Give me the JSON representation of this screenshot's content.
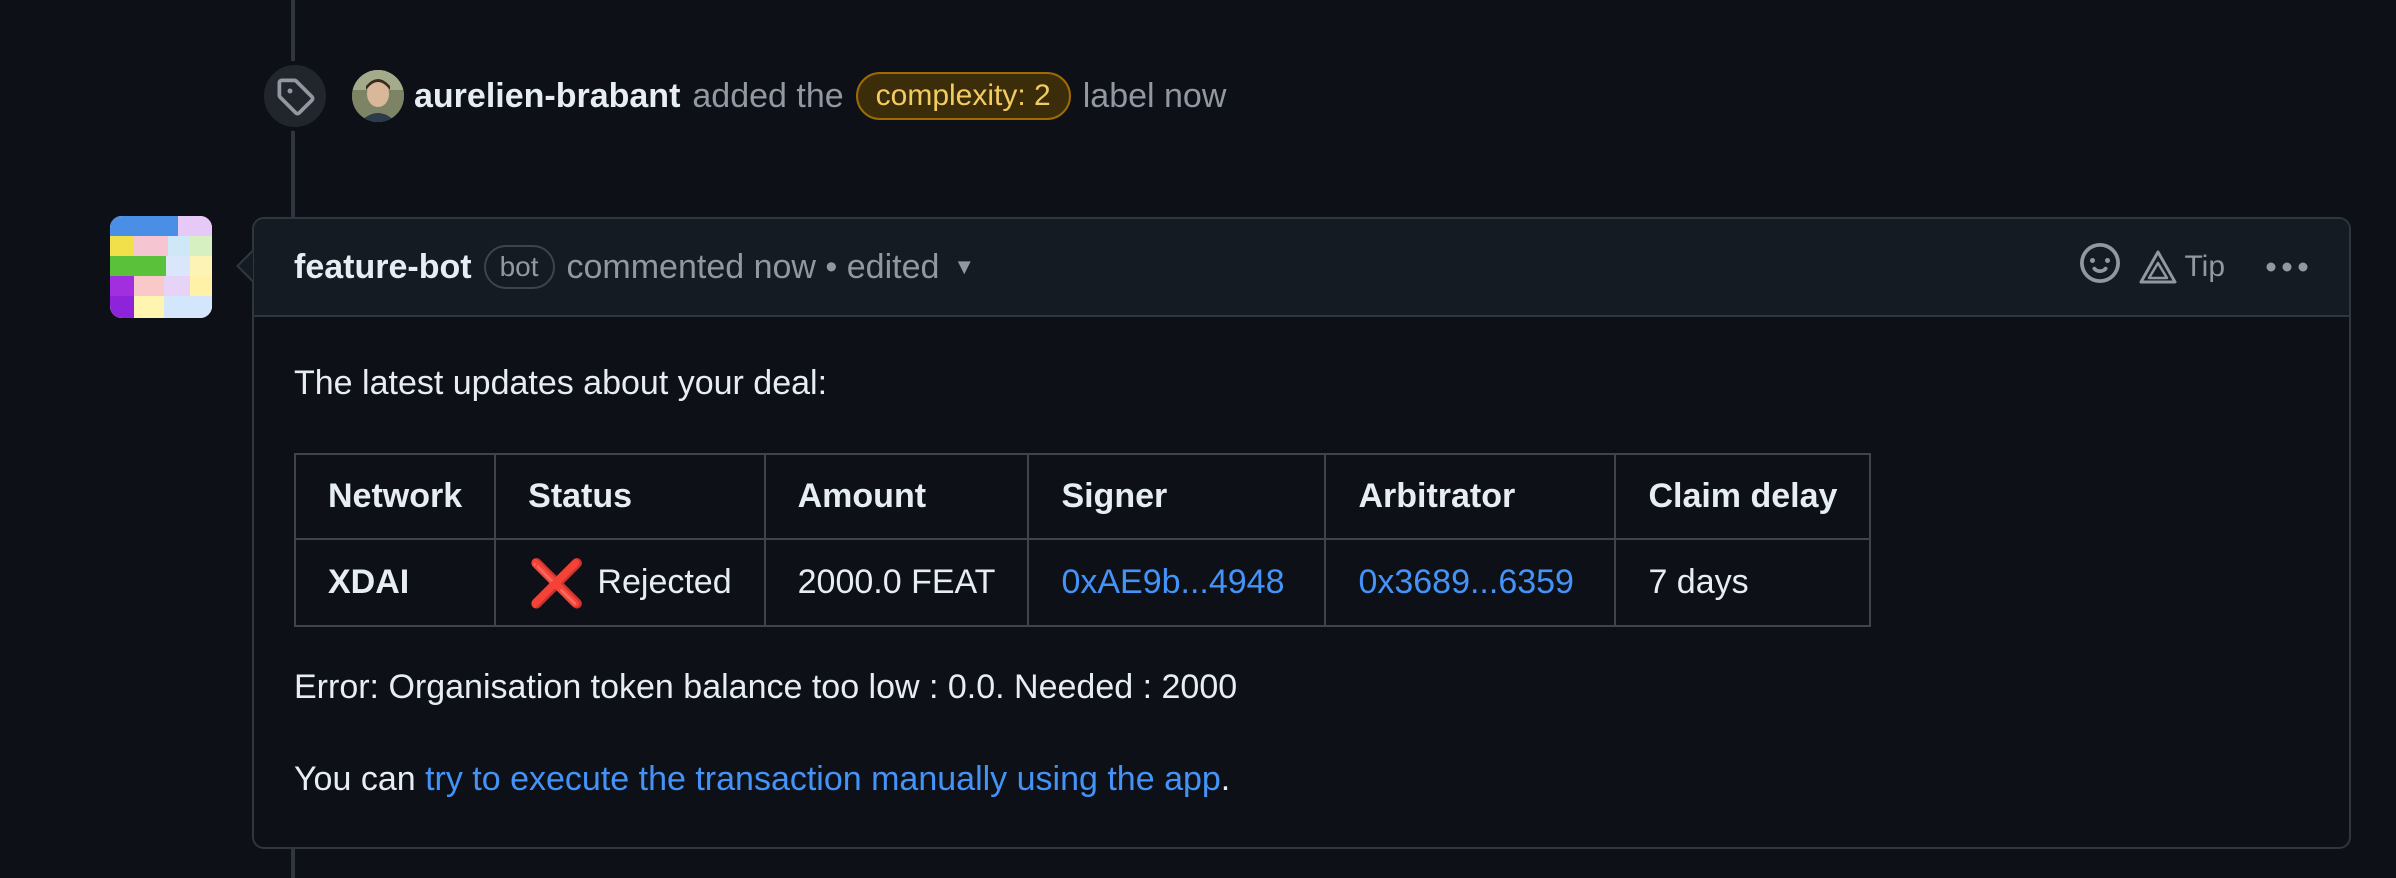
{
  "event": {
    "user": "aurelien-brabant",
    "action": "added the",
    "label": "complexity: 2",
    "tail": "label now",
    "icon": "tag-icon"
  },
  "comment": {
    "author": "feature-bot",
    "badge": "bot",
    "meta": "commented now • edited",
    "tip": "Tip",
    "intro": "The latest updates about your deal:",
    "table": {
      "headers": [
        "Network",
        "Status",
        "Amount",
        "Signer",
        "Arbitrator",
        "Claim delay"
      ],
      "row": {
        "network": "XDAI",
        "status_icon": "❌",
        "status": "Rejected",
        "amount": "2000.0 FEAT",
        "signer": "0xAE9b...4948",
        "arbitrator": "0x3689...6359",
        "claim_delay": "7 days"
      }
    },
    "error": "Error: Organisation token balance too low : 0.0. Needed : 2000",
    "manual_prefix": "You can ",
    "manual_link": "try to execute the transaction manually using the app",
    "manual_suffix": "."
  },
  "colors": {
    "background": "#0d1117",
    "link": "#4493f8",
    "label_text": "#f2cc60",
    "label_border": "#9e6a03",
    "reject": "#e5181b"
  }
}
